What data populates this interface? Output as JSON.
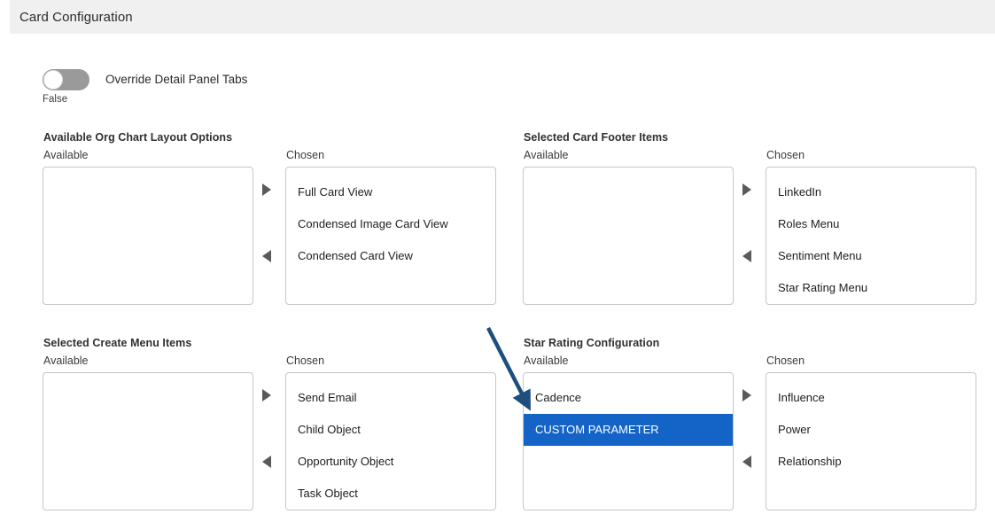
{
  "header": {
    "title": "Card Configuration"
  },
  "toggle": {
    "state_label": "False",
    "label": "Override Detail Panel Tabs",
    "checked": false
  },
  "common": {
    "available_label": "Available",
    "chosen_label": "Chosen",
    "move_right_icon": "triangle-right-icon",
    "move_left_icon": "triangle-left-icon"
  },
  "sections": [
    {
      "title": "Available Org Chart Layout Options",
      "available": [],
      "chosen": [
        "Full Card View",
        "Condensed Image Card View",
        "Condensed Card View"
      ]
    },
    {
      "title": "Selected Card Footer Items",
      "available": [],
      "chosen": [
        "LinkedIn",
        "Roles Menu",
        "Sentiment Menu",
        "Star Rating Menu"
      ]
    },
    {
      "title": "Selected Create Menu Items",
      "available": [],
      "chosen": [
        "Send Email",
        "Child Object",
        "Opportunity Object",
        "Task Object"
      ]
    },
    {
      "title": "Star Rating Configuration",
      "available": [
        "Cadence",
        "CUSTOM PARAMETER"
      ],
      "available_selected_index": 1,
      "chosen": [
        "Influence",
        "Power",
        "Relationship"
      ]
    }
  ],
  "colors": {
    "selection_blue": "#1464c8",
    "header_gray": "#f0f0f0",
    "annotation_arrow": "#1c4e7e",
    "transfer_arrow": "#5a5a5a",
    "toggle_track": "#9a9a9a"
  },
  "annotation": {
    "name": "pointer-arrow",
    "points_to": "CUSTOM PARAMETER"
  }
}
